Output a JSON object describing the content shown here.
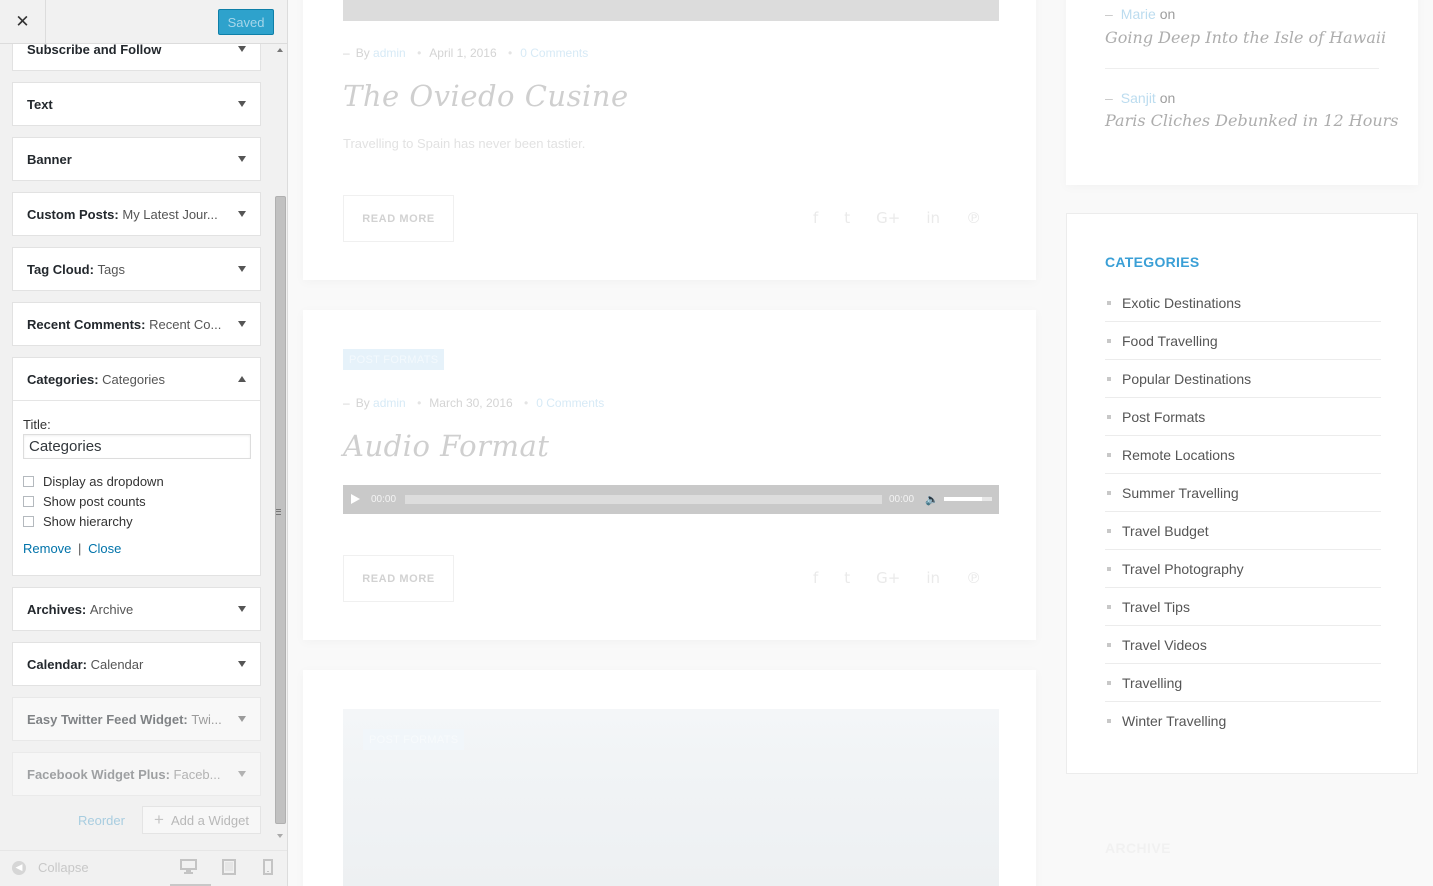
{
  "customizer": {
    "close_icon": "close-icon",
    "saved_label": "Saved",
    "widgets": [
      {
        "title": "Subscribe and Follow",
        "subtitle": ""
      },
      {
        "title": "Text",
        "subtitle": ""
      },
      {
        "title": "Banner",
        "subtitle": ""
      },
      {
        "title": "Custom Posts",
        "subtitle": "My Latest Jour..."
      },
      {
        "title": "Tag Cloud",
        "subtitle": "Tags"
      },
      {
        "title": "Recent Comments",
        "subtitle": "Recent Co..."
      },
      {
        "title": "Categories",
        "subtitle": "Categories"
      },
      {
        "title": "Archives",
        "subtitle": "Archive"
      },
      {
        "title": "Calendar",
        "subtitle": "Calendar"
      },
      {
        "title": "Easy Twitter Feed Widget",
        "subtitle": "Twi..."
      },
      {
        "title": "Facebook Widget Plus",
        "subtitle": "Faceb..."
      }
    ],
    "categories_form": {
      "title_label": "Title:",
      "title_value": "Categories",
      "options": [
        {
          "label": "Display as dropdown",
          "checked": false
        },
        {
          "label": "Show post counts",
          "checked": false
        },
        {
          "label": "Show hierarchy",
          "checked": false
        }
      ],
      "remove_label": "Remove",
      "separator": "|",
      "close_label": "Close"
    },
    "reorder_label": "Reorder",
    "add_widget_label": "Add a Widget",
    "collapse_label": "Collapse",
    "devices": [
      "desktop-icon",
      "tablet-icon",
      "mobile-icon"
    ]
  },
  "preview": {
    "posts": [
      {
        "by": "By",
        "author": "admin",
        "date": "April 1, 2016",
        "comments": "0 Comments",
        "title": "The Oviedo Cusine",
        "excerpt": "Travelling to Spain has never been tastier.",
        "read_more": "READ MORE"
      },
      {
        "tag": "POST FORMATS",
        "by": "By",
        "author": "admin",
        "date": "March 30, 2016",
        "comments": "0 Comments",
        "title": "Audio Format",
        "audio": {
          "current": "00:00",
          "duration": "00:00",
          "volume_fraction": 0.8
        },
        "read_more": "READ MORE"
      },
      {
        "tag": "POST FORMATS"
      }
    ],
    "social_icons": [
      "facebook-icon",
      "twitter-icon",
      "google-plus-icon",
      "linkedin-icon",
      "pinterest-icon"
    ],
    "recent_comments": [
      {
        "author": "Marie",
        "on": "on",
        "post": "Going Deep Into the Isle of Hawaii"
      },
      {
        "author": "Sanjit",
        "on": "on",
        "post": "Paris Cliches Debunked in 12 Hours"
      }
    ],
    "categories_heading": "CATEGORIES",
    "categories": [
      "Exotic Destinations",
      "Food Travelling",
      "Popular Destinations",
      "Post Formats",
      "Remote Locations",
      "Summer Travelling",
      "Travel Budget",
      "Travel Photography",
      "Travel Tips",
      "Travel Videos",
      "Travelling",
      "Winter Travelling"
    ],
    "archive_heading": "ARCHIVE"
  }
}
